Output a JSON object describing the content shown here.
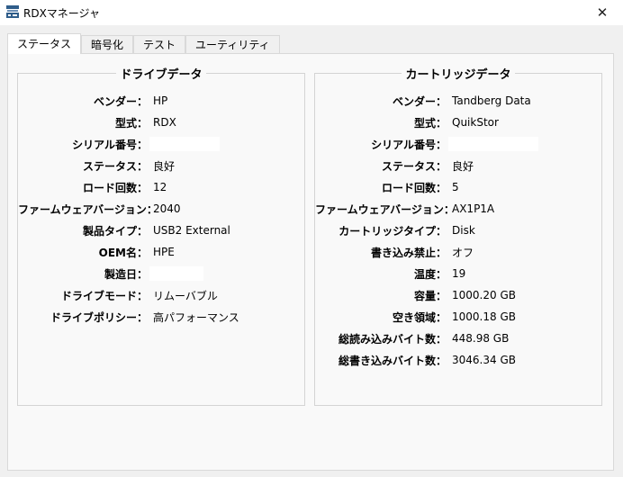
{
  "window": {
    "title": "RDXマネージャ",
    "close_glyph": "✕"
  },
  "tabs": [
    {
      "label": "ステータス",
      "active": true
    },
    {
      "label": "暗号化",
      "active": false
    },
    {
      "label": "テスト",
      "active": false
    },
    {
      "label": "ユーティリティ",
      "active": false
    }
  ],
  "drive": {
    "title": "ドライブデータ",
    "vendor_label": "ベンダー：",
    "vendor": "HP",
    "model_label": "型式：",
    "model": "RDX",
    "serial_label": "シリアル番号：",
    "status_label": "ステータス：",
    "status": "良好",
    "load_count_label": "ロード回数：",
    "load_count": "12",
    "firmware_label": "ファームウェアバージョン：",
    "firmware": "2040",
    "product_type_label": "製品タイプ：",
    "product_type": "USB2 External",
    "oem_label": "OEM名：",
    "oem": "HPE",
    "mfg_date_label": "製造日：",
    "drive_mode_label": "ドライブモード：",
    "drive_mode": "リムーバブル",
    "drive_policy_label": "ドライブポリシー：",
    "drive_policy": "高パフォーマンス"
  },
  "cartridge": {
    "title": "カートリッジデータ",
    "vendor_label": "ベンダー：",
    "vendor": "Tandberg Data",
    "model_label": "型式：",
    "model": "QuikStor",
    "serial_label": "シリアル番号：",
    "status_label": "ステータス：",
    "status": "良好",
    "load_count_label": "ロード回数：",
    "load_count": "5",
    "firmware_label": "ファームウェアバージョン：",
    "firmware": "AX1P1A",
    "type_label": "カートリッジタイプ：",
    "type": "Disk",
    "write_protect_label": "書き込み禁止：",
    "write_protect": "オフ",
    "temperature_label": "温度：",
    "temperature": "19",
    "capacity_label": "容量：",
    "capacity": "1000.20 GB",
    "free_space_label": "空き領域：",
    "free_space": "1000.18 GB",
    "total_read_label": "総読み込みバイト数：",
    "total_read": "448.98 GB",
    "total_written_label": "総書き込みバイト数：",
    "total_written": "3046.34 GB"
  },
  "colors": {
    "background": "#f0f0f0",
    "panel": "#f9f9f9",
    "border": "#d9d9d9",
    "icon_blue": "#2f5d8a"
  }
}
